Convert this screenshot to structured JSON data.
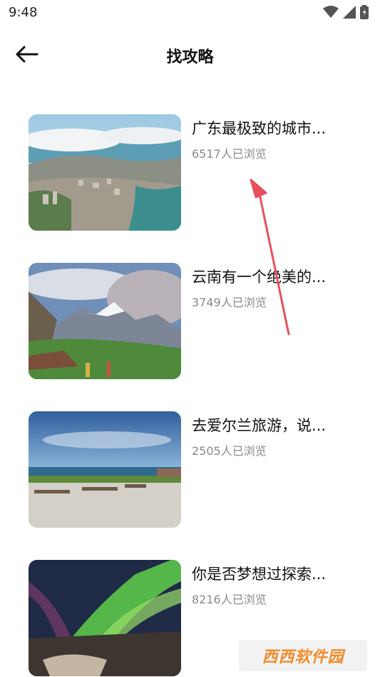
{
  "status_bar": {
    "time": "9:48",
    "icons": [
      "wifi-icon",
      "signal-icon",
      "battery-icon"
    ]
  },
  "header": {
    "back_icon": "arrow-left-icon",
    "title": "找攻略"
  },
  "articles": [
    {
      "title": "广东最极致的城市...",
      "views": "6517人已浏览",
      "image": "coastal-city-aerial"
    },
    {
      "title": "云南有一个绝美的...",
      "views": "3749人已浏览",
      "image": "snow-mountain-valley"
    },
    {
      "title": "去爱尔兰旅游，说...",
      "views": "2505人已浏览",
      "image": "ireland-coast-benches"
    },
    {
      "title": "你是否梦想过探索...",
      "views": "8216人已浏览",
      "image": "aurora-waterfall"
    }
  ],
  "watermark": {
    "text": "西西软件园"
  },
  "colors": {
    "annotation_arrow": "#e8505b",
    "title_text": "#111111",
    "views_text": "#8a8a8a"
  }
}
